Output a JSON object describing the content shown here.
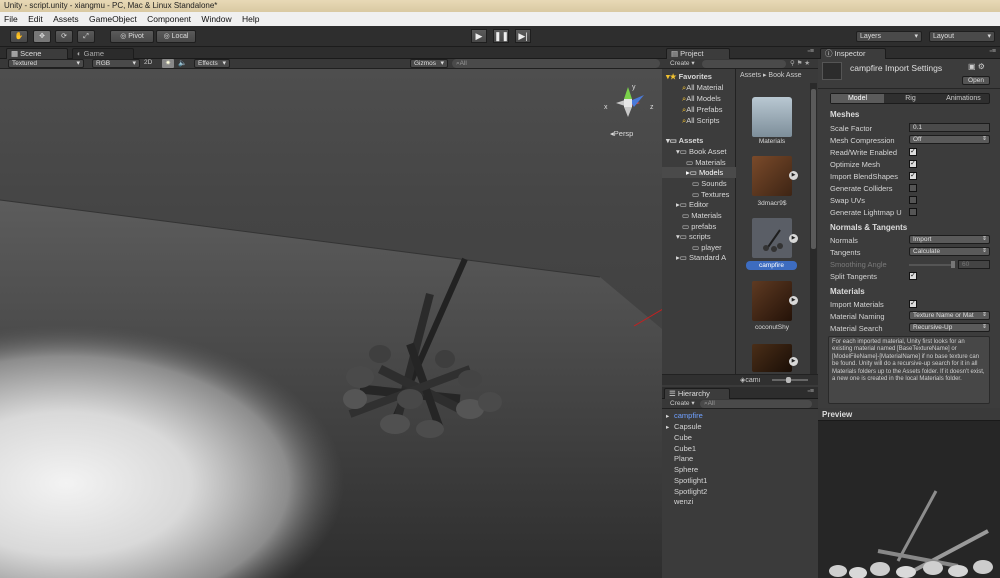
{
  "window": {
    "title": "Unity - script.unity - xiangmu - PC, Mac & Linux Standalone*"
  },
  "menu": [
    "File",
    "Edit",
    "Assets",
    "GameObject",
    "Component",
    "Window",
    "Help"
  ],
  "toolbar": {
    "pivot": "Pivot",
    "local": "Local",
    "layers": "Layers",
    "layout": "Layout"
  },
  "scene": {
    "tab_scene": "Scene",
    "tab_game": "Game",
    "shading": "Textured",
    "render": "RGB",
    "mode2d": "2D",
    "effects": "Effects",
    "gizmos": "Gizmos",
    "search_placeholder": "All",
    "persp": "Persp",
    "axis_x": "x",
    "axis_y": "y",
    "axis_z": "z"
  },
  "project": {
    "tab": "Project",
    "create": "Create",
    "favorites": {
      "label": "Favorites",
      "items": [
        "All Material",
        "All Models",
        "All Prefabs",
        "All Scripts"
      ]
    },
    "assets": {
      "label": "Assets",
      "children": [
        "Book Asset",
        "Materials",
        "Models",
        "Sounds",
        "Textures",
        "Editor",
        "Materials",
        "prefabs",
        "scripts",
        "player",
        "Standard A"
      ]
    },
    "breadcrumb": [
      "Assets",
      "Book Asse"
    ],
    "thumbs": [
      "Materials",
      "3dmacr9$",
      "campfire",
      "coconutShy",
      "camı"
    ]
  },
  "inspector": {
    "tab": "Inspector",
    "title": "campfire Import Settings",
    "open": "Open",
    "tabs": [
      "Model",
      "Rig",
      "Animations"
    ],
    "meshes": {
      "header": "Meshes",
      "scale_factor_label": "Scale Factor",
      "scale_factor": "0.1",
      "mesh_compression_label": "Mesh Compression",
      "mesh_compression": "Off",
      "read_write": "Read/Write Enabled",
      "optimize": "Optimize Mesh",
      "blendshapes": "Import BlendShapes",
      "colliders": "Generate Colliders",
      "swap_uvs": "Swap UVs",
      "lightmap": "Generate Lightmap U"
    },
    "normals": {
      "header": "Normals & Tangents",
      "normals_label": "Normals",
      "normals": "Import",
      "tangents_label": "Tangents",
      "tangents": "Calculate",
      "smoothing_label": "Smoothing Angle",
      "smoothing": "60",
      "split": "Split Tangents"
    },
    "materials": {
      "header": "Materials",
      "import": "Import Materials",
      "naming_label": "Material Naming",
      "naming": "Texture Name or Mat",
      "search_label": "Material Search",
      "search": "Recursive-Up",
      "help": "For each imported material, Unity first looks for an existing material named [BaseTextureName] or [ModelFileName]-[MaterialName] if no base texture can be found. Unity will do a recursive-up search for it in all Materials folders up to the Assets folder. If it doesn't exist, a new one is created in the local Materials folder."
    },
    "preview": "Preview"
  },
  "hierarchy": {
    "tab": "Hierarchy",
    "create": "Create",
    "search_placeholder": "All",
    "items": [
      "campfire",
      "Capsule",
      "Cube",
      "Cube1",
      "Plane",
      "Sphere",
      "Spotlight1",
      "Spotlight2",
      "wenzi"
    ]
  }
}
